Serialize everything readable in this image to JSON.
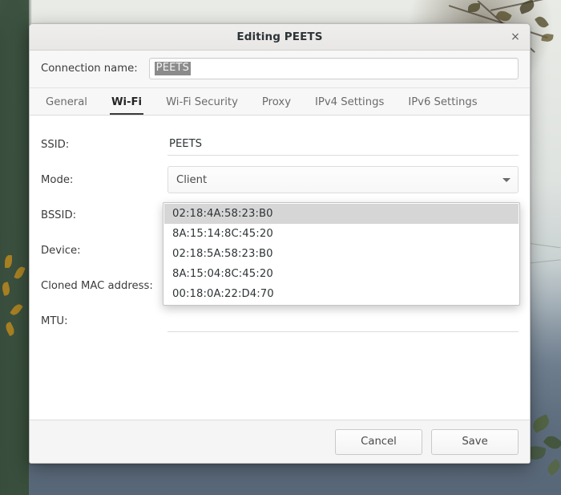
{
  "window": {
    "title": "Editing PEETS",
    "close_icon": "close-icon",
    "close_glyph": "×"
  },
  "connection": {
    "label": "Connection name:",
    "value": "PEETS",
    "selected": true
  },
  "tabs": [
    {
      "label": "General",
      "active": false
    },
    {
      "label": "Wi-Fi",
      "active": true
    },
    {
      "label": "Wi-Fi Security",
      "active": false
    },
    {
      "label": "Proxy",
      "active": false
    },
    {
      "label": "IPv4 Settings",
      "active": false
    },
    {
      "label": "IPv6 Settings",
      "active": false
    }
  ],
  "form": {
    "ssid": {
      "label": "SSID:",
      "value": "PEETS"
    },
    "mode": {
      "label": "Mode:",
      "value": "Client",
      "caret_icon": "chevron-down-icon"
    },
    "bssid": {
      "label": "BSSID:",
      "value": "",
      "caret_icon": "chevron-down-icon"
    },
    "device": {
      "label": "Device:",
      "value": ""
    },
    "cloned_mac": {
      "label": "Cloned MAC address:",
      "value": ""
    },
    "mtu": {
      "label": "MTU:",
      "value": ""
    }
  },
  "bssid_dropdown": {
    "open": true,
    "options": [
      {
        "label": "02:18:4A:58:23:B0",
        "selected": true
      },
      {
        "label": "8A:15:14:8C:45:20",
        "selected": false
      },
      {
        "label": "02:18:5A:58:23:B0",
        "selected": false
      },
      {
        "label": "8A:15:04:8C:45:20",
        "selected": false
      },
      {
        "label": "00:18:0A:22:D4:70",
        "selected": false
      }
    ]
  },
  "footer": {
    "cancel_label": "Cancel",
    "save_label": "Save"
  },
  "colors": {
    "titlebar_bg": "#eeedec",
    "dialog_bg": "#ffffff",
    "tab_active": "#252525",
    "tab_inactive": "#6b6b6b",
    "selection_bg": "#8b8b8b",
    "dropdown_highlight": "#d6d6d6",
    "bssid_button_bg": "#686868"
  }
}
